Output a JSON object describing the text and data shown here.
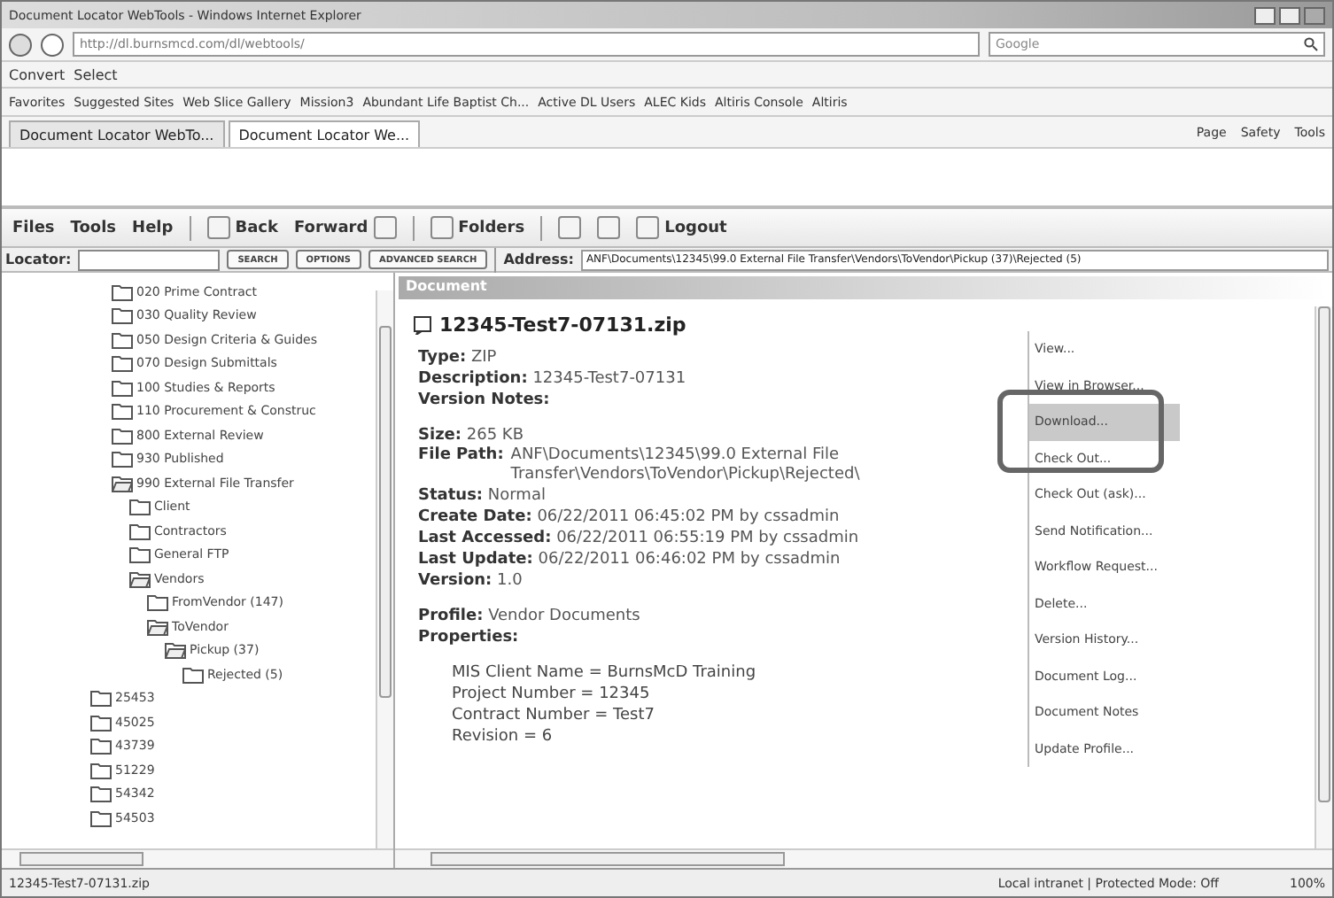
{
  "window": {
    "title": "Document Locator WebTools - Windows Internet Explorer"
  },
  "address_bar": {
    "url": "http://dl.burnsmcd.com/dl/webtools/",
    "search_placeholder": "Google"
  },
  "command_bar": [
    "Convert",
    "Select"
  ],
  "favorites_bar": [
    "Favorites",
    "Suggested Sites",
    "Web Slice Gallery",
    "Mission3",
    "Abundant Life Baptist Ch...",
    "Active DL Users",
    "ALEC Kids",
    "Altiris Console",
    "Altiris"
  ],
  "browser_tabs": [
    {
      "label": "Document Locator WebTo...",
      "selected": false
    },
    {
      "label": "Document Locator We...",
      "selected": true
    }
  ],
  "browser_tools": [
    "Page",
    "Safety",
    "Tools"
  ],
  "app_menu": [
    "Files",
    "Tools",
    "Help"
  ],
  "app_toolbar": {
    "back": "Back",
    "forward": "Forward",
    "folders": "Folders",
    "logout": "Logout"
  },
  "locator": {
    "label": "Locator:",
    "buttons": [
      "SEARCH",
      "OPTIONS",
      "ADVANCED SEARCH"
    ],
    "address_label": "Address:",
    "address": "ANF\\Documents\\12345\\99.0 External File Transfer\\Vendors\\ToVendor\\Pickup (37)\\Rejected (5)"
  },
  "tree": {
    "continued_items": [
      {
        "label": "020 Prime Contract",
        "expanded": false
      },
      {
        "label": "030 Quality Review",
        "expanded": false
      },
      {
        "label": "050 Design Criteria & Guides",
        "expanded": false
      },
      {
        "label": "070 Design Submittals",
        "expanded": false
      },
      {
        "label": "100 Studies & Reports",
        "expanded": false
      },
      {
        "label": "110 Procurement & Construc",
        "expanded": false
      },
      {
        "label": "800 External Review",
        "expanded": false
      },
      {
        "label": "930 Published",
        "expanded": false
      },
      {
        "label": "990 External File Transfer",
        "expanded": true,
        "children": [
          {
            "label": "Client",
            "expanded": false
          },
          {
            "label": "Contractors",
            "expanded": false
          },
          {
            "label": "General FTP",
            "expanded": false
          },
          {
            "label": "Vendors",
            "expanded": true,
            "children": [
              {
                "label": "FromVendor (147)",
                "expanded": false
              },
              {
                "label": "ToVendor",
                "expanded": true,
                "children": [
                  {
                    "label": "Pickup (37)",
                    "expanded": true,
                    "children": [
                      {
                        "label": "Rejected (5)",
                        "expanded": false
                      }
                    ]
                  }
                ]
              }
            ]
          }
        ]
      }
    ],
    "items": [
      {
        "label": "25453",
        "expanded": false
      },
      {
        "label": "45025",
        "expanded": false
      },
      {
        "label": "43739",
        "expanded": false
      },
      {
        "label": "51229",
        "expanded": false
      },
      {
        "label": "54342",
        "expanded": false
      },
      {
        "label": "54503",
        "expanded": false
      }
    ]
  },
  "panel": {
    "title": "Document",
    "file_name": "12345-Test7-07131.zip",
    "field_groups": [
      [
        {
          "label": "Type:",
          "value": "ZIP"
        },
        {
          "label": "Description:",
          "value": "12345-Test7-07131"
        },
        {
          "label": "Version Notes:"
        }
      ],
      [
        {
          "label": "Size:",
          "value": "265 KB"
        },
        {
          "label": "File Path:",
          "value": "ANF\\Documents\\12345\\99.0 External File Transfer\\Vendors\\ToVendor\\Pickup\\Rejected\\",
          "kind": "wrapped"
        },
        {
          "label": "Status:",
          "value": "Normal"
        },
        {
          "label": "Create Date:",
          "value": "06/22/2011 06:45:02 PM by cssadmin"
        },
        {
          "label": "Last Accessed:",
          "value": "06/22/2011 06:55:19 PM by cssadmin"
        },
        {
          "label": "Last Update:",
          "value": "06/22/2011 06:46:02 PM by cssadmin"
        },
        {
          "label": "Version:",
          "value": "1.0"
        }
      ],
      [
        {
          "label": "Profile:",
          "value": "Vendor Documents"
        },
        {
          "label": "Properties:"
        }
      ]
    ],
    "properties": [
      "MIS Client Name = BurnsMcD Training",
      "Project Number = 12345",
      "Contract Number = Test7",
      "Revision = 6"
    ],
    "actions": [
      {
        "label": "View...",
        "selected": false
      },
      {
        "label": "View in Browser...",
        "selected": false
      },
      {
        "label": "Download...",
        "selected": true
      },
      {
        "label": "Check Out...",
        "selected": false
      },
      {
        "label": "Check Out (ask)...",
        "selected": false
      },
      {
        "label": "Send Notification...",
        "selected": false
      },
      {
        "label": "Workflow Request...",
        "selected": false
      },
      {
        "label": "Delete...",
        "selected": false
      },
      {
        "label": "Version History...",
        "selected": false
      },
      {
        "label": "Document Log...",
        "selected": false
      },
      {
        "label": "Document Notes",
        "selected": false
      },
      {
        "label": "Update Profile...",
        "selected": false
      }
    ]
  },
  "status_bar": {
    "text": "12345-Test7-07131.zip",
    "zone": "Local intranet | Protected Mode: Off",
    "zoom": "100%"
  }
}
